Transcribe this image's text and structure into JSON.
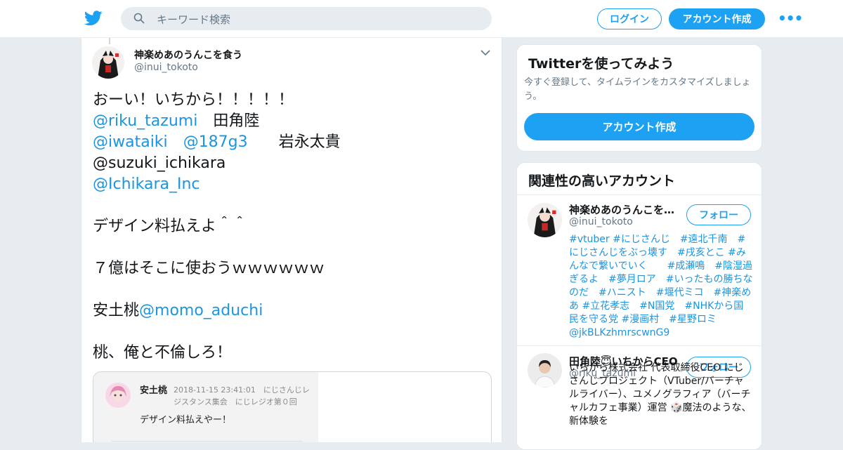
{
  "search": {
    "placeholder": "キーワード検索"
  },
  "header": {
    "login_label": "ログイン",
    "signup_label": "アカウント作成",
    "more_label": "•••"
  },
  "tweet": {
    "author_name": "神楽めあのうんこを食う",
    "author_handle": "@inui_tokoto",
    "lines": [
      [
        {
          "t": "おーい！いちから！！！！！",
          "m": false
        }
      ],
      [
        {
          "t": "@riku_tazumi",
          "m": true
        },
        {
          "t": "　田角陸",
          "m": false
        }
      ],
      [
        {
          "t": "@iwataiki",
          "m": true
        },
        {
          "t": "　",
          "m": false
        },
        {
          "t": "@187g3",
          "m": true
        },
        {
          "t": "　　岩永太貴",
          "m": false
        }
      ],
      [
        {
          "t": "@suzuki_ichikara",
          "m": false
        }
      ],
      [
        {
          "t": "@Ichikara_Inc",
          "m": true
        }
      ],
      [],
      [
        {
          "t": "デザイン料払えよ＾＾",
          "m": false
        }
      ],
      [],
      [
        {
          "t": "７億はそこに使おうｗｗｗｗｗｗ",
          "m": false
        }
      ],
      [],
      [
        {
          "t": "安土桃",
          "m": false
        },
        {
          "t": "@momo_aduchi",
          "m": true
        }
      ],
      [],
      [
        {
          "t": "桃、俺と不倫しろ！",
          "m": false
        }
      ]
    ],
    "card": {
      "name": "安土桃",
      "meta": "2018-11-15 23:41:01　にじさんじレジスタンス集会　にじレジオ第０回",
      "text": "デザイン料払えやー！"
    }
  },
  "signup_panel": {
    "title": "Twitterを使ってみよう",
    "description": "今すぐ登録して、タイムラインをカスタマイズしましょう。",
    "button_label": "アカウント作成"
  },
  "related_panel": {
    "title": "関連性の高いアカウント",
    "accounts": [
      {
        "name": "神楽めあのうんこを食う",
        "handle": "@inui_tokoto",
        "follow_label": "フォロー",
        "bio": "#vtuber #にじさんじ　#遠北千南　#にじさんじをぶっ壊す　#戌亥とこ #みんなで繋いでいく　　#成瀬鳴　#陰湿過ぎるよ　#夢月ロア　#いったもの勝ちなのだ　#ハニスト　#堰代ミコ　#神楽めあ #立花孝志　#N国党　#NHKから国民を守る党 #漫画村　#星野ロミ @jkBLKzhmrscwnG9"
      },
      {
        "name": "田角陸😇いちからCEO",
        "handle": "@riku_tazumi",
        "follow_label": "フォロー",
        "bio": "いちから株式会社 代表取締役CEO にじさんじプロジェクト（VTuber/バーチャルライバー）、ユメノグラフィア（バーチャルカフェ事業）運営 🎲魔法のような、新体験を"
      }
    ]
  },
  "colors": {
    "accent": "#1da1f2",
    "link": "#1b95e0",
    "background": "#e6ecf0"
  },
  "icons": [
    "twitter-bird-icon",
    "search-icon",
    "more-icon",
    "chevron-down-icon"
  ]
}
